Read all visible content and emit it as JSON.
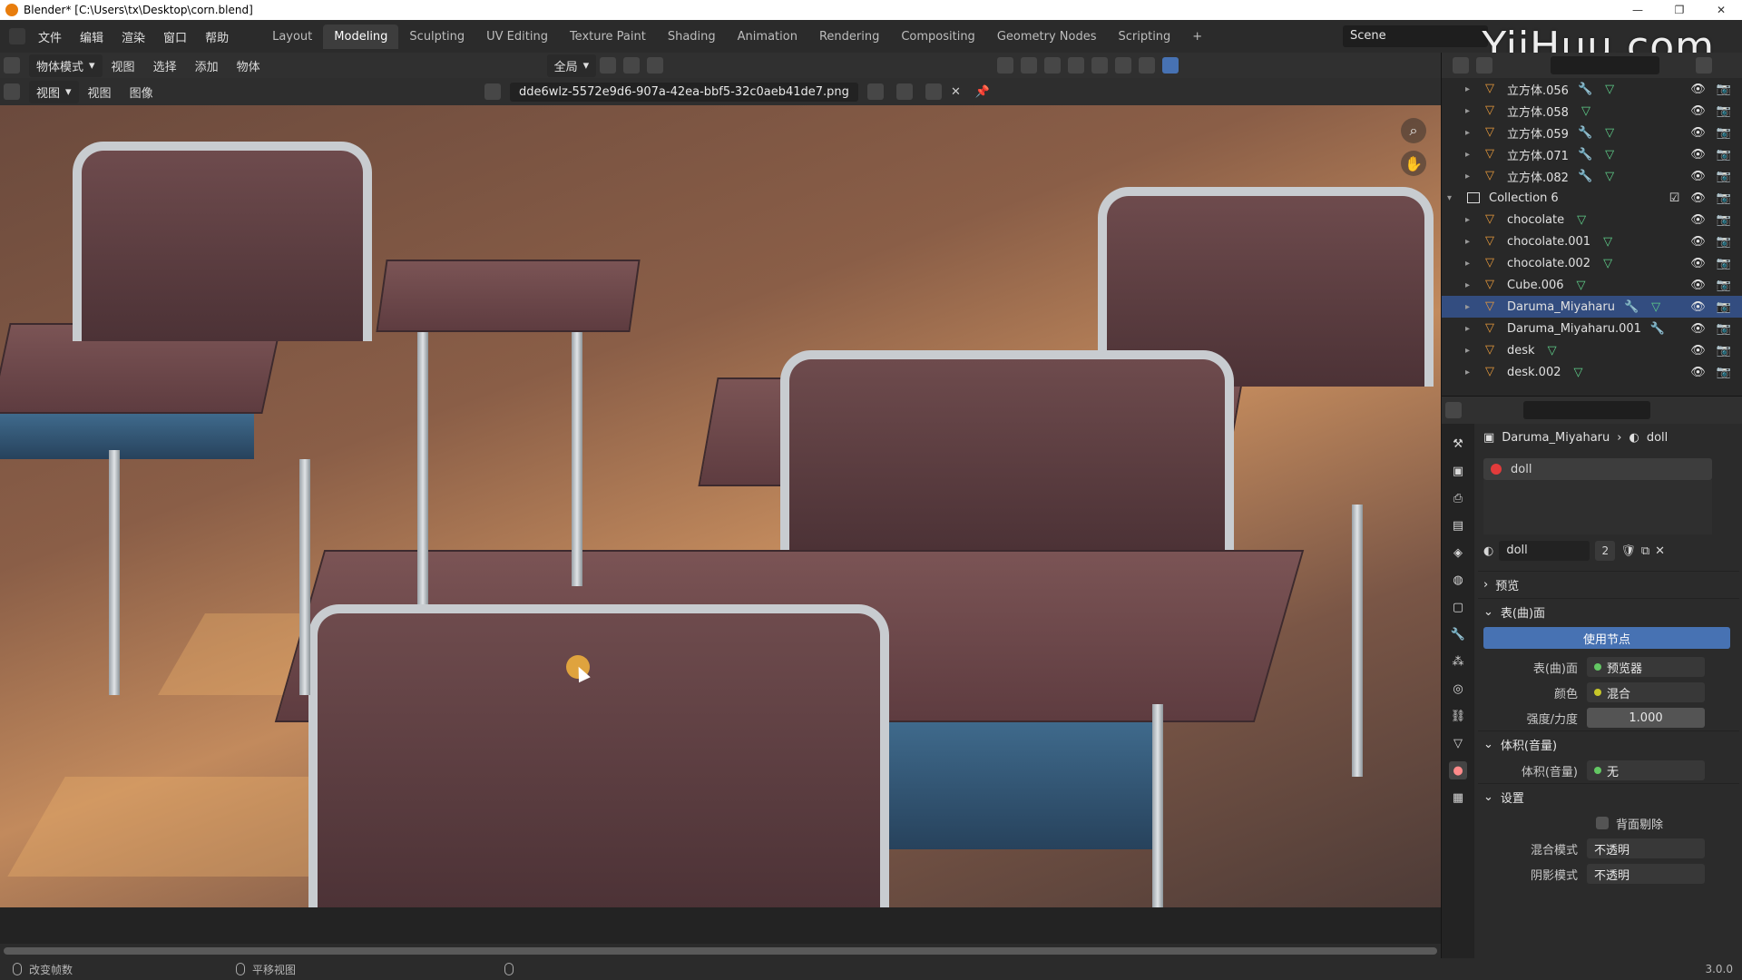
{
  "title_bar": {
    "title": "Blender* [C:\\Users\\tx\\Desktop\\corn.blend]",
    "min": "—",
    "max": "❐",
    "close": "✕"
  },
  "watermark": "YiiHuu.com",
  "menus": [
    "文件",
    "编辑",
    "渲染",
    "窗口",
    "帮助"
  ],
  "workspaces": [
    "Layout",
    "Modeling",
    "Sculpting",
    "UV Editing",
    "Texture Paint",
    "Shading",
    "Animation",
    "Rendering",
    "Compositing",
    "Geometry Nodes",
    "Scripting",
    "+"
  ],
  "active_workspace": "Modeling",
  "scene": "Scene",
  "toolbar": {
    "mode": "物体模式",
    "menus": [
      "视图",
      "选择",
      "添加",
      "物体"
    ],
    "transform": "全局"
  },
  "image_editor": {
    "view_label": "视图",
    "menus": [
      "视图",
      "图像"
    ],
    "filename": "dde6wlz-5572e9d6-907a-42ea-bbf5-32c0aeb41de7.png"
  },
  "outliner": {
    "rows": [
      {
        "name": "立方体.056",
        "kind": "object",
        "mod": true,
        "mesh": true
      },
      {
        "name": "立方体.058",
        "kind": "object",
        "mod": false,
        "mesh": true
      },
      {
        "name": "立方体.059",
        "kind": "object",
        "mod": true,
        "mesh": true
      },
      {
        "name": "立方体.071",
        "kind": "object",
        "mod": true,
        "mesh": true
      },
      {
        "name": "立方体.082",
        "kind": "object",
        "mod": true,
        "mesh": true
      },
      {
        "name": "Collection 6",
        "kind": "collection"
      },
      {
        "name": "chocolate",
        "kind": "object",
        "mod": false,
        "mesh": true
      },
      {
        "name": "chocolate.001",
        "kind": "object",
        "mod": false,
        "mesh": true
      },
      {
        "name": "chocolate.002",
        "kind": "object",
        "mod": false,
        "mesh": true
      },
      {
        "name": "Cube.006",
        "kind": "object",
        "mod": false,
        "mesh": true
      },
      {
        "name": "Daruma_Miyaharu",
        "kind": "object",
        "mod": true,
        "mesh": true,
        "selected": true
      },
      {
        "name": "Daruma_Miyaharu.001",
        "kind": "object",
        "mod": true,
        "mesh": false
      },
      {
        "name": "desk",
        "kind": "object",
        "mod": false,
        "mesh": true
      },
      {
        "name": "desk.002",
        "kind": "object",
        "mod": false,
        "mesh": true
      }
    ]
  },
  "properties": {
    "breadcrumb_object": "Daruma_Miyaharu",
    "breadcrumb_material": "doll",
    "slot_material": "doll",
    "material_name": "doll",
    "material_users": "2",
    "sections": {
      "preview": "预览",
      "surface": "表(曲)面",
      "volume": "体积(音量)",
      "settings": "设置"
    },
    "use_nodes": "使用节点",
    "surface_label": "表(曲)面",
    "surface_value": "预览器",
    "color_label": "颜色",
    "color_value": "混合",
    "strength_label": "强度/力度",
    "strength_value": "1.000",
    "volume_label": "体积(音量)",
    "volume_value": "无",
    "backface_label": "背面剔除",
    "blend_mode_label": "混合模式",
    "blend_mode_value": "不透明",
    "shadow_mode_label": "阴影模式",
    "shadow_mode_value": "不透明"
  },
  "status_bar": {
    "left": "改变帧数",
    "middle": "平移视图",
    "version": "3.0.0"
  },
  "colors": {
    "selected_row": "#334d80",
    "use_nodes": "#4772b3",
    "material_dot": "#e23b3b",
    "orange_icon": "#e89a3c"
  }
}
